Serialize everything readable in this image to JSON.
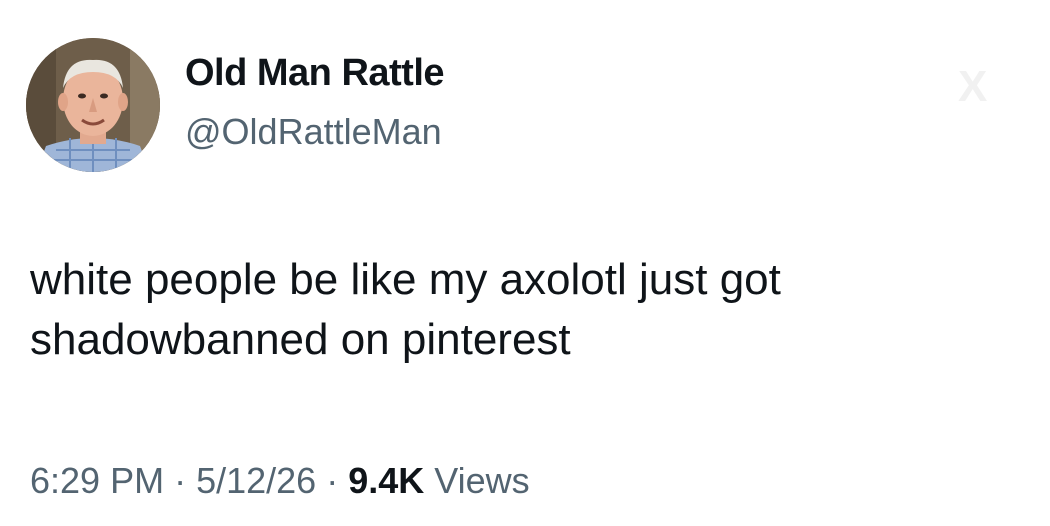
{
  "author": {
    "display_name": "Old Man Rattle",
    "handle": "@OldRattleMan",
    "avatar": "elderly-man-portrait"
  },
  "tweet": {
    "lines": [
      "white people be like my axolotl just got",
      "shadowbanned on pinterest"
    ],
    "time": "6:29 PM",
    "date": "5/12/26",
    "separator": "·",
    "views_count": "9.4K",
    "views_label": "Views"
  },
  "watermark": "X",
  "colors": {
    "text": "#0f1419",
    "secondary": "#536471",
    "background": "#ffffff"
  }
}
